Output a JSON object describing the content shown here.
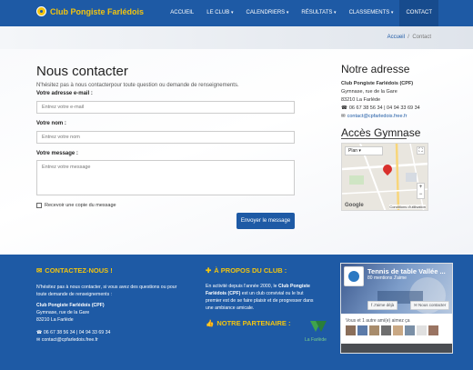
{
  "navbar": {
    "brand": "Club Pongiste Farlédois",
    "items": [
      {
        "label": "ACCUEIL",
        "caret": false,
        "active": false
      },
      {
        "label": "LE CLUB",
        "caret": true,
        "active": false
      },
      {
        "label": "CALENDRIERS",
        "caret": true,
        "active": false
      },
      {
        "label": "RÉSULTATS",
        "caret": true,
        "active": false
      },
      {
        "label": "CLASSEMENTS",
        "caret": true,
        "active": false
      },
      {
        "label": "CONTACT",
        "caret": false,
        "active": true
      }
    ],
    "caret_glyph": "▾"
  },
  "breadcrumb": {
    "home": "Accueil",
    "separator": "/",
    "current": "Contact"
  },
  "contact": {
    "title": "Nous contacter",
    "intro": "N'hésitez pas à nous contacterpour toute question ou demande de renseignements.",
    "email_label": "Votre adresse e-mail :",
    "email_placeholder": "Entrez votre e-mail",
    "name_label": "Votre nom :",
    "name_placeholder": "Entrez votre nom",
    "message_label": "Votre message :",
    "message_placeholder": "Entrez votre message",
    "copy_label": "Recevoir une copie du message",
    "submit_label": "Envoyer le message"
  },
  "address": {
    "title": "Notre adresse",
    "club": "Club Pongiste Farlédois (CPF)",
    "line1": "Gymnase, rue de la Gare",
    "line2": "83210 La Farlède",
    "phone": "06 67 38 56 34 | 04 94 33 69 34",
    "email": "contact@cpfarledois.free.fr"
  },
  "gym": {
    "title": "Accès Gymnase",
    "map_type": "Plan",
    "map_type_caret": "▾",
    "fullscreen": "⛶",
    "zoom_in": "+",
    "zoom_out": "−",
    "google": "Google",
    "terms": "Conditions d'utilisation"
  },
  "footer": {
    "contact_title": "CONTACTEZ-NOUS !",
    "contact_intro_1": "N'hésitez pas à nous contacter, si vous avez des questions ou pour",
    "contact_intro_2": "toute demande de renseignements :",
    "club": "Club Pongiste Farlédois (CPF)",
    "line1": "Gymnase, rue de la Gare",
    "line2": "83210 La Farlède",
    "phone": "06 67 38 56 34 | 04 94 33 69 34",
    "email": "contact@cpfarledois.free.fr",
    "about_title": "À PROPOS DU CLUB :",
    "about_1a": "En activité depuis l'année 2000, le ",
    "about_1b": "Club Pongiste",
    "about_2a": "Farlédois (CPF)",
    "about_2b": " est un club convivial ou le but",
    "about_3": "premier est de se faire plaisir et de progresser dans",
    "about_4": "une ambiance amicale.",
    "partner_title": "NOTRE PARTENAIRE :",
    "partner_name": "La Farlède"
  },
  "facebook": {
    "page_name": "Tennis de table Vallée ...",
    "likes": "80 mentions J'aime",
    "like_button": "J'aime déjà",
    "contact_button": "Nous contacter",
    "friends": "Vous et 1 autre ami(e) aimez ça"
  },
  "colors": {
    "brand_blue": "#1e5aa5",
    "brand_yellow": "#f2c40f",
    "facebook_blue": "#4267b2"
  }
}
